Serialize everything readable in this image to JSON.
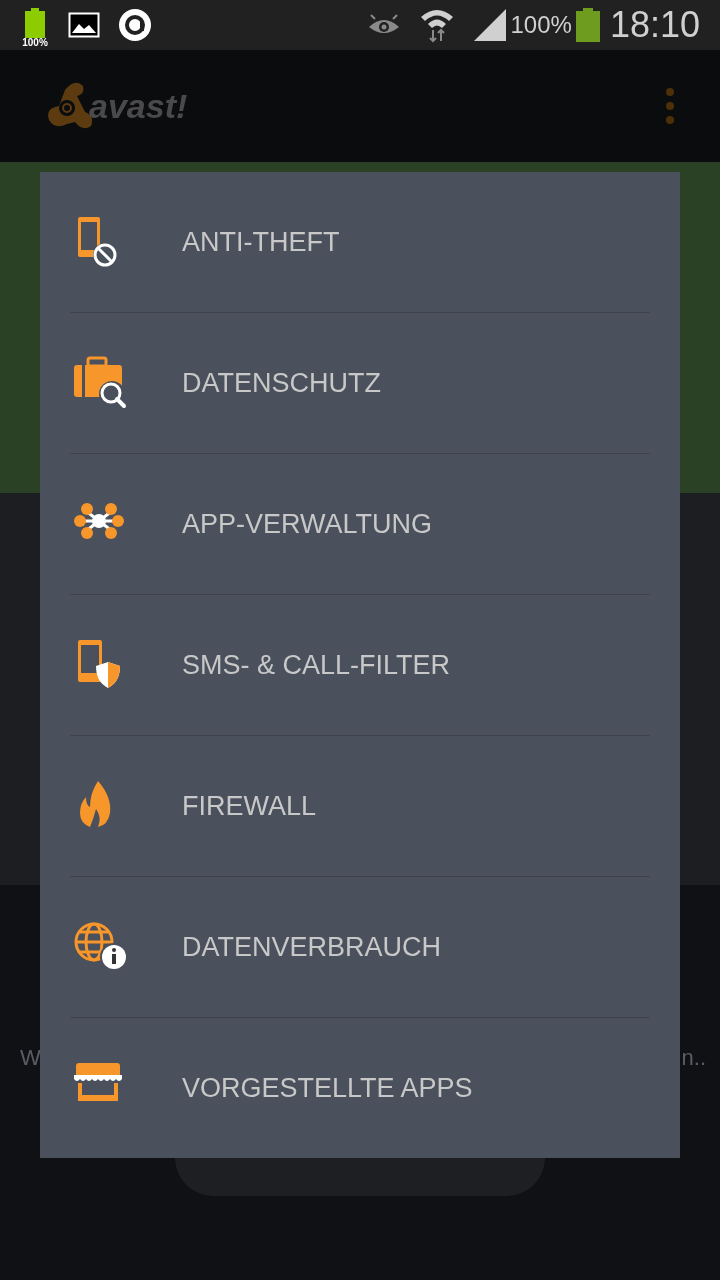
{
  "status_bar": {
    "battery_badge": "100%",
    "battery": "100%",
    "time": "18:10"
  },
  "app_bar": {
    "logo": "avast!"
  },
  "background": {
    "left_text": "W",
    "right_text": "n.."
  },
  "menu": {
    "items": [
      {
        "kind": "phone-block",
        "label": "ANTI-THEFT"
      },
      {
        "kind": "case-search",
        "label": "DATENSCHUTZ"
      },
      {
        "kind": "network",
        "label": "APP-VERWALTUNG"
      },
      {
        "kind": "phone-shield",
        "label": "SMS- & CALL-FILTER"
      },
      {
        "kind": "flame",
        "label": "FIREWALL"
      },
      {
        "kind": "globe-info",
        "label": "DATENVERBRAUCH"
      },
      {
        "kind": "store",
        "label": "VORGESTELLTE APPS"
      }
    ]
  }
}
